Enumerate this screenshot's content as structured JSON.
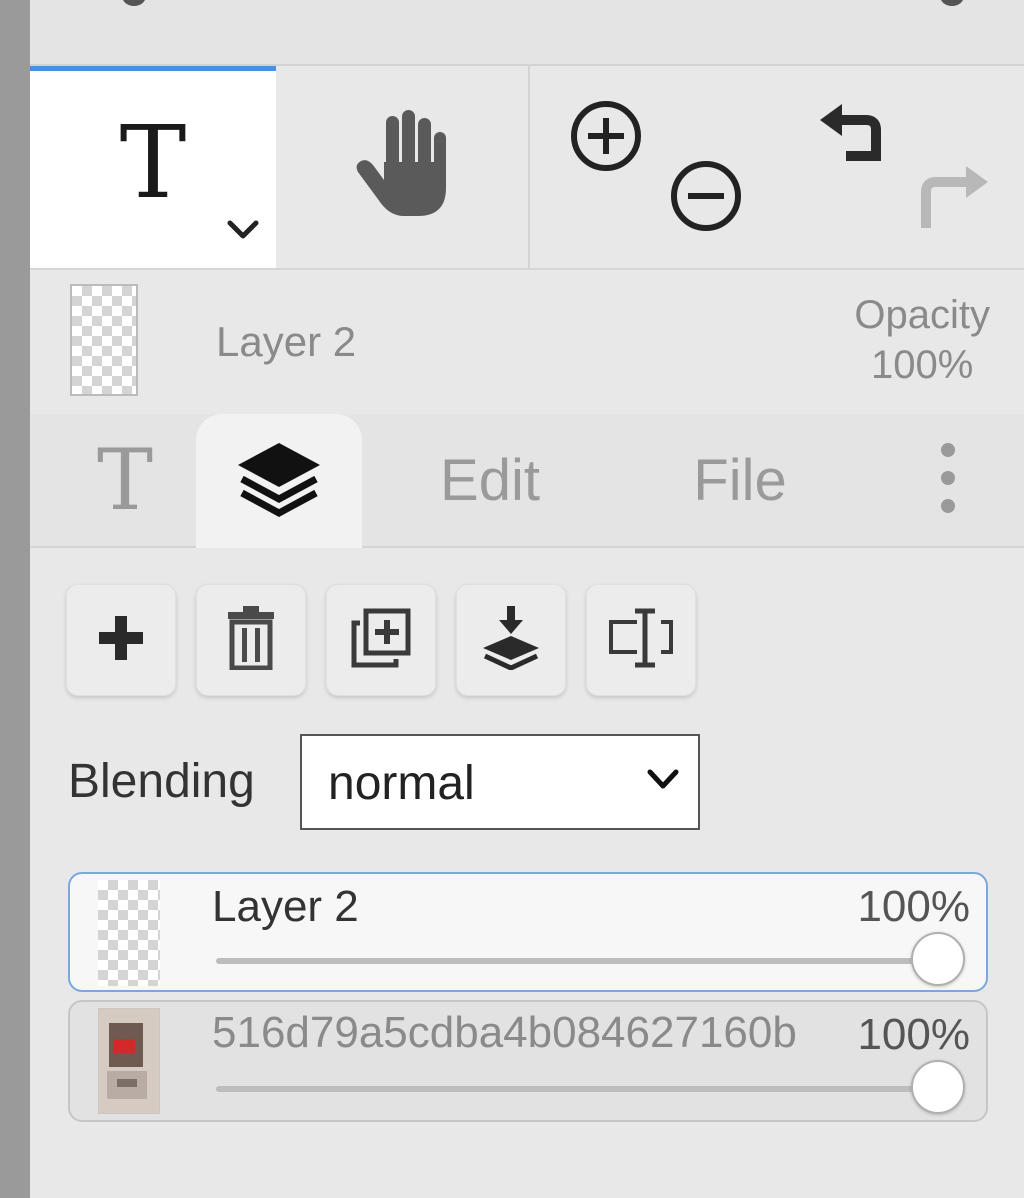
{
  "toolbar": {
    "tools": [
      {
        "name": "text-tool",
        "label": "T",
        "active": true
      },
      {
        "name": "hand-tool",
        "icon": "hand-icon"
      },
      {
        "name": "zoom-in",
        "icon": "zoom-in-icon"
      },
      {
        "name": "zoom-out",
        "icon": "zoom-out-icon"
      },
      {
        "name": "undo",
        "icon": "undo-icon"
      },
      {
        "name": "redo",
        "icon": "redo-icon"
      }
    ],
    "accent_color": "#4a90e2"
  },
  "active_layer": {
    "name": "Layer 2",
    "opacity_label": "Opacity",
    "opacity_value": "100%"
  },
  "tabs": {
    "text_tab": "T",
    "layers_tab_icon": "layers-icon",
    "edit": "Edit",
    "file": "File",
    "more_icon": "more-vertical-icon"
  },
  "layer_actions": [
    {
      "name": "add-layer",
      "icon": "plus-icon"
    },
    {
      "name": "delete-layer",
      "icon": "trash-icon"
    },
    {
      "name": "duplicate-layer",
      "icon": "duplicate-icon"
    },
    {
      "name": "merge-down",
      "icon": "merge-down-icon"
    },
    {
      "name": "rename-layer",
      "icon": "text-cursor-icon"
    }
  ],
  "blending": {
    "label": "Blending",
    "value": "normal"
  },
  "layers": [
    {
      "name": "Layer 2",
      "opacity": "100%",
      "opacity_fraction": 1.0,
      "selected": true
    },
    {
      "name": "516d79a5cdba4b084627160b",
      "opacity": "100%",
      "opacity_fraction": 1.0,
      "selected": false
    }
  ]
}
